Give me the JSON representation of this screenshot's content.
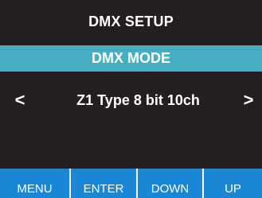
{
  "screen": {
    "title": "DMX SETUP",
    "mode_label": "DMX MODE",
    "value": "Z1 Type 8 bit 10ch",
    "prev_symbol": "<",
    "next_symbol": ">"
  },
  "softkeys": [
    {
      "label": "MENU"
    },
    {
      "label": "ENTER"
    },
    {
      "label": "DOWN"
    },
    {
      "label": "UP"
    }
  ],
  "colors": {
    "background": "#231f20",
    "mode_bar": "#45aec2",
    "softkey": "#1a86d6",
    "text": "#ffffff"
  }
}
